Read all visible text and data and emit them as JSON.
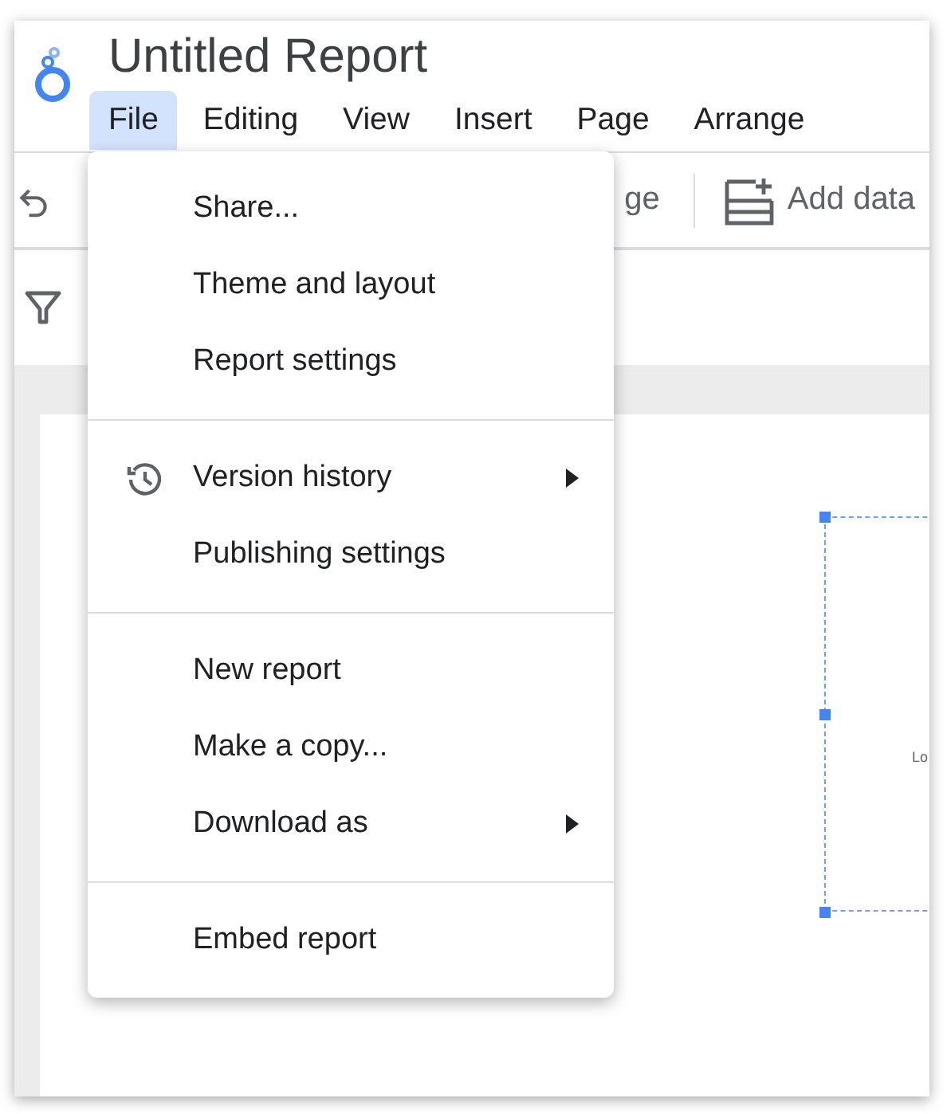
{
  "title": "Untitled Report",
  "menubar": [
    {
      "label": "File",
      "selected": true
    },
    {
      "label": "Editing",
      "selected": false
    },
    {
      "label": "View",
      "selected": false
    },
    {
      "label": "Insert",
      "selected": false
    },
    {
      "label": "Page",
      "selected": false
    },
    {
      "label": "Arrange",
      "selected": false
    }
  ],
  "toolbar": {
    "covered_button": "ge",
    "add_data": "Add data"
  },
  "canvas": {
    "chart_label": "Lo"
  },
  "file_menu": {
    "groups": [
      [
        {
          "label": "Share...",
          "kind": "plain",
          "submenu": false
        },
        {
          "label": "Theme and layout",
          "kind": "plain",
          "submenu": false
        },
        {
          "label": "Report settings",
          "kind": "plain",
          "submenu": false
        }
      ],
      [
        {
          "label": "Version history",
          "kind": "iconic",
          "submenu": true
        },
        {
          "label": "Publishing settings",
          "kind": "plain",
          "submenu": false
        }
      ],
      [
        {
          "label": "New report",
          "kind": "plain",
          "submenu": false
        },
        {
          "label": "Make a copy...",
          "kind": "plain",
          "submenu": false
        },
        {
          "label": "Download as",
          "kind": "plain",
          "submenu": true
        }
      ],
      [
        {
          "label": "Embed report",
          "kind": "plain",
          "submenu": false
        }
      ]
    ]
  }
}
